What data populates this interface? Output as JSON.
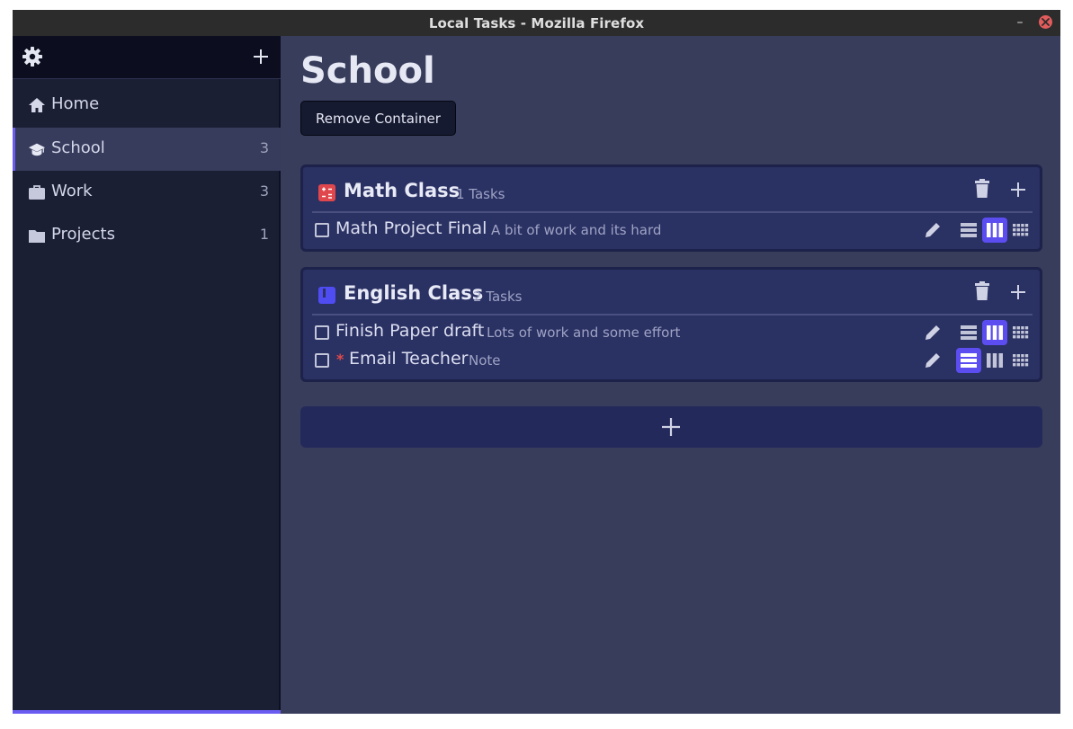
{
  "window": {
    "title": "Local Tasks - Mozilla Firefox",
    "minimize_glyph": "–"
  },
  "sidebar": {
    "settings_icon": "gear-icon",
    "add_icon": "plus-icon",
    "items": [
      {
        "label": "Home",
        "icon": "home-icon",
        "count": ""
      },
      {
        "label": "School",
        "icon": "graduation-cap-icon",
        "count": "3",
        "active": true
      },
      {
        "label": "Work",
        "icon": "briefcase-icon",
        "count": "3"
      },
      {
        "label": "Projects",
        "icon": "folder-icon",
        "count": "1"
      }
    ],
    "accent_color": "#6a5cf0"
  },
  "main": {
    "title": "School",
    "remove_button": "Remove Container",
    "cards": [
      {
        "title": "Math Class",
        "count": "1 Tasks",
        "icon": "calculator-icon",
        "icon_color": "#e0474c",
        "tasks": [
          {
            "title": "Math Project Final",
            "note": "A bit of work and its hard",
            "starred": false,
            "view": "columns"
          }
        ]
      },
      {
        "title": "English Class",
        "count": "2 Tasks",
        "icon": "book-icon",
        "icon_color": "#4f4cf2",
        "tasks": [
          {
            "title": "Finish Paper draft",
            "note": "Lots of work and some effort",
            "starred": false,
            "view": "columns"
          },
          {
            "title": "Email Teacher",
            "note": "Note",
            "starred": true,
            "star": "*",
            "view": "rows"
          }
        ]
      }
    ],
    "add_card_icon": "plus-icon"
  },
  "colors": {
    "background": "#383d5c",
    "card": "#2a3163",
    "sidebar": "#1b1f34",
    "active_view": "#5b4df0",
    "star": "#e04a4a"
  }
}
